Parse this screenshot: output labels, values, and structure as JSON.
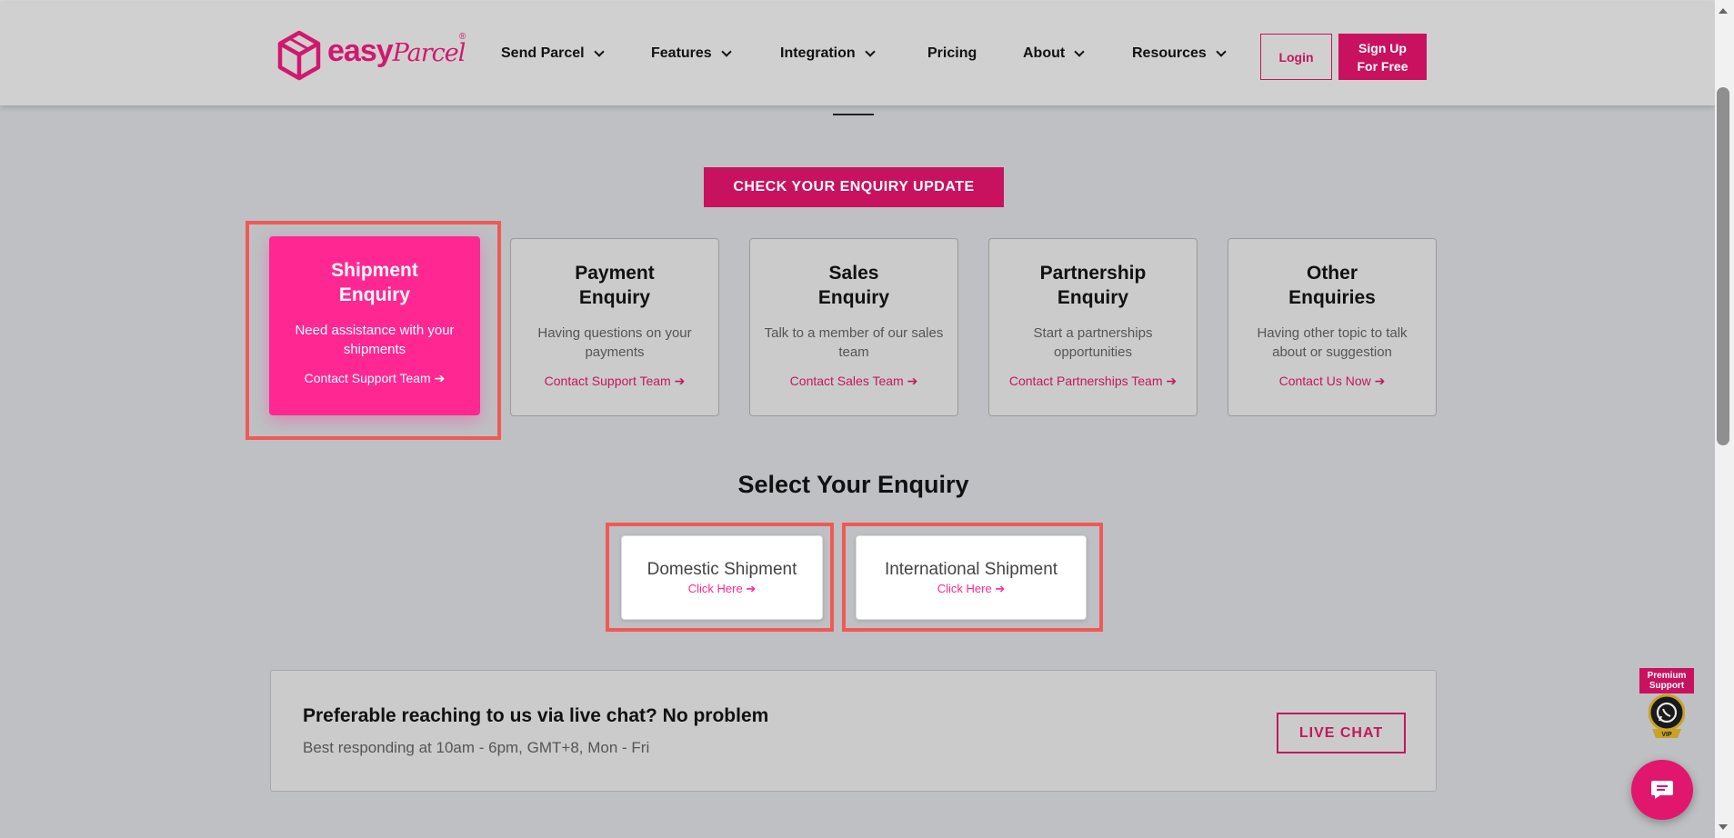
{
  "header": {
    "logo": {
      "word": "easy",
      "script": "Parcel",
      "reg": "®"
    },
    "nav": [
      {
        "label": "Send Parcel",
        "has_dropdown": true
      },
      {
        "label": "Features",
        "has_dropdown": true
      },
      {
        "label": "Integration",
        "has_dropdown": true
      },
      {
        "label": "Pricing",
        "has_dropdown": false
      },
      {
        "label": "About",
        "has_dropdown": true
      },
      {
        "label": "Resources",
        "has_dropdown": true
      }
    ],
    "login_label": "Login",
    "signup_line1": "Sign Up",
    "signup_line2": "For Free"
  },
  "cta_update": "CHECK YOUR ENQUIRY UPDATE",
  "cards": [
    {
      "title1": "Shipment",
      "title2": "Enquiry",
      "desc": "Need assistance with your shipments",
      "link": "Contact Support Team",
      "active": true
    },
    {
      "title1": "Payment",
      "title2": "Enquiry",
      "desc": "Having questions on your payments",
      "link": "Contact Support Team",
      "active": false
    },
    {
      "title1": "Sales",
      "title2": "Enquiry",
      "desc": "Talk to a member of our sales team",
      "link": "Contact Sales Team",
      "active": false
    },
    {
      "title1": "Partnership",
      "title2": "Enquiry",
      "desc": "Start a partnerships opportunities",
      "link": "Contact Partnerships Team",
      "active": false
    },
    {
      "title1": "Other",
      "title2": "Enquiries",
      "desc": "Having other topic to talk about or suggestion",
      "link": "Contact Us Now",
      "active": false
    }
  ],
  "select_title": "Select Your Enquiry",
  "shipments": [
    {
      "title": "Domestic Shipment",
      "link": "Click Here"
    },
    {
      "title": "International Shipment",
      "link": "Click Here"
    }
  ],
  "live_chat": {
    "heading": "Preferable reaching to us via live chat? No problem",
    "sub": "Best responding at 10am - 6pm, GMT+8, Mon - Fri",
    "button": "LIVE CHAT"
  },
  "premium": {
    "line1": "Premium",
    "line2": "Support",
    "vip": "VIP"
  },
  "colors": {
    "brand": "#c8125f",
    "active_card": "#ff2791",
    "highlight": "#f05a55"
  },
  "icons": [
    "box-logo-icon",
    "chevron-down-icon",
    "arrow-right-icon",
    "whatsapp-icon",
    "chat-bubble-icon"
  ]
}
